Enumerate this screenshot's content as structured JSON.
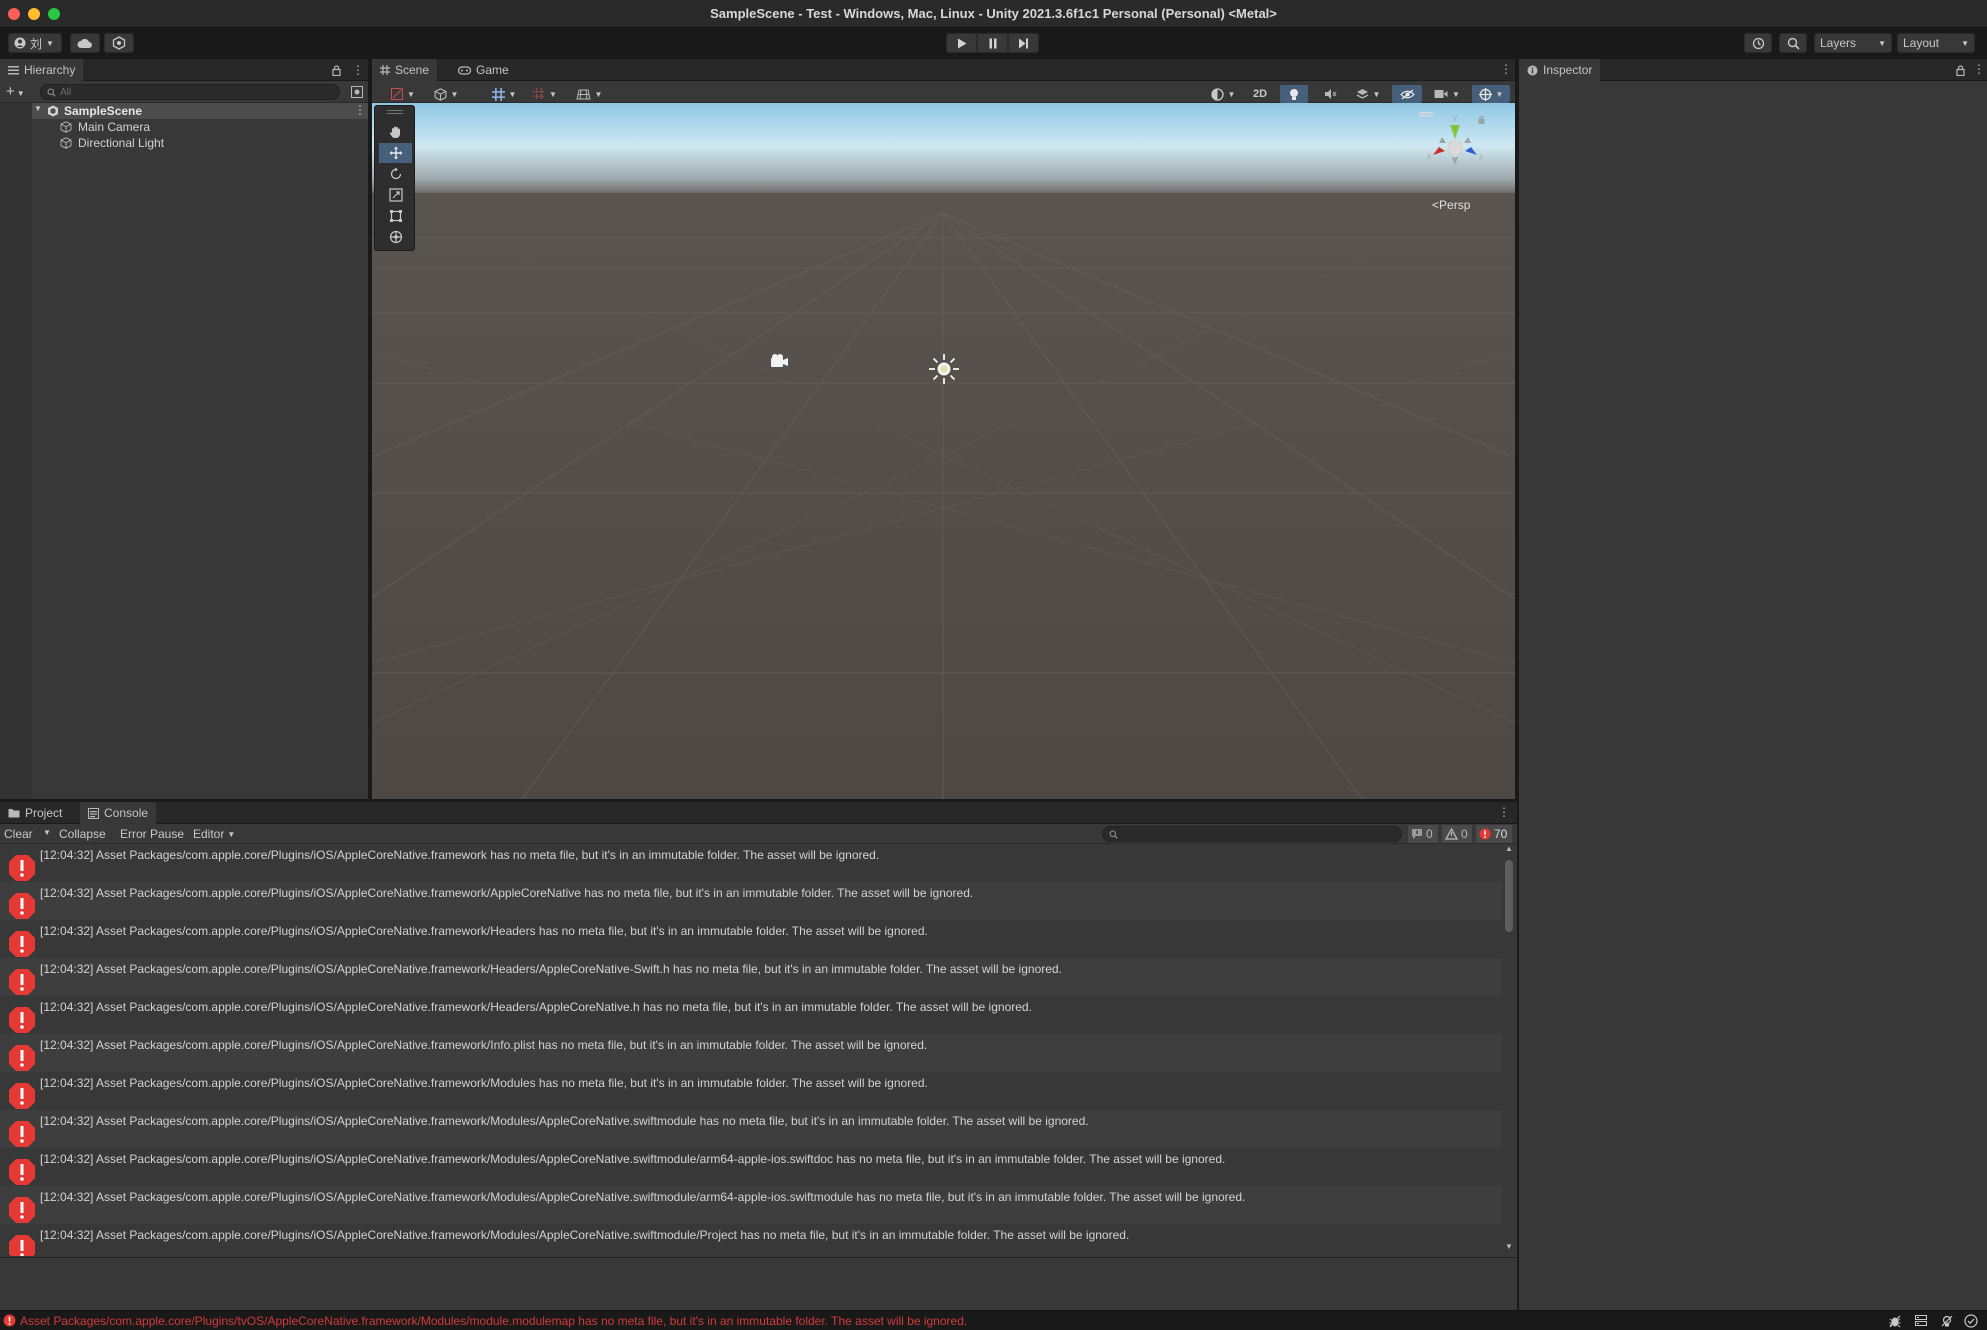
{
  "window": {
    "title": "SampleScene - Test - Windows, Mac, Linux - Unity 2021.3.6f1c1 Personal (Personal) <Metal>"
  },
  "toolbar": {
    "account_label": "刘",
    "layers_label": "Layers",
    "layout_label": "Layout"
  },
  "hierarchy": {
    "tab_label": "Hierarchy",
    "search_placeholder": "All",
    "scene_name": "SampleScene",
    "items": [
      {
        "label": "Main Camera"
      },
      {
        "label": "Directional Light"
      }
    ]
  },
  "scene": {
    "tabs": [
      {
        "label": "Scene"
      },
      {
        "label": "Game"
      }
    ],
    "toggle_2d": "2D",
    "persp_label": "Persp"
  },
  "inspector": {
    "tab_label": "Inspector"
  },
  "console": {
    "tabs": [
      {
        "label": "Project"
      },
      {
        "label": "Console"
      }
    ],
    "clear_label": "Clear",
    "collapse_label": "Collapse",
    "error_pause_label": "Error Pause",
    "editor_label": "Editor",
    "info_count": "0",
    "warning_count": "0",
    "error_count": "70",
    "logs": [
      {
        "text": "[12:04:32] Asset Packages/com.apple.core/Plugins/iOS/AppleCoreNative.framework has no meta file, but it's in an immutable folder. The asset will be ignored."
      },
      {
        "text": "[12:04:32] Asset Packages/com.apple.core/Plugins/iOS/AppleCoreNative.framework/AppleCoreNative has no meta file, but it's in an immutable folder. The asset will be ignored."
      },
      {
        "text": "[12:04:32] Asset Packages/com.apple.core/Plugins/iOS/AppleCoreNative.framework/Headers has no meta file, but it's in an immutable folder. The asset will be ignored."
      },
      {
        "text": "[12:04:32] Asset Packages/com.apple.core/Plugins/iOS/AppleCoreNative.framework/Headers/AppleCoreNative-Swift.h has no meta file, but it's in an immutable folder. The asset will be ignored."
      },
      {
        "text": "[12:04:32] Asset Packages/com.apple.core/Plugins/iOS/AppleCoreNative.framework/Headers/AppleCoreNative.h has no meta file, but it's in an immutable folder. The asset will be ignored."
      },
      {
        "text": "[12:04:32] Asset Packages/com.apple.core/Plugins/iOS/AppleCoreNative.framework/Info.plist has no meta file, but it's in an immutable folder. The asset will be ignored."
      },
      {
        "text": "[12:04:32] Asset Packages/com.apple.core/Plugins/iOS/AppleCoreNative.framework/Modules has no meta file, but it's in an immutable folder. The asset will be ignored."
      },
      {
        "text": "[12:04:32] Asset Packages/com.apple.core/Plugins/iOS/AppleCoreNative.framework/Modules/AppleCoreNative.swiftmodule has no meta file, but it's in an immutable folder. The asset will be ignored."
      },
      {
        "text": "[12:04:32] Asset Packages/com.apple.core/Plugins/iOS/AppleCoreNative.framework/Modules/AppleCoreNative.swiftmodule/arm64-apple-ios.swiftdoc has no meta file, but it's in an immutable folder. The asset will be ignored."
      },
      {
        "text": "[12:04:32] Asset Packages/com.apple.core/Plugins/iOS/AppleCoreNative.framework/Modules/AppleCoreNative.swiftmodule/arm64-apple-ios.swiftmodule has no meta file, but it's in an immutable folder. The asset will be ignored."
      },
      {
        "text": "[12:04:32] Asset Packages/com.apple.core/Plugins/iOS/AppleCoreNative.framework/Modules/AppleCoreNative.swiftmodule/Project has no meta file, but it's in an immutable folder. The asset will be ignored."
      }
    ]
  },
  "statusbar": {
    "message": "Asset Packages/com.apple.core/Plugins/tvOS/AppleCoreNative.framework/Modules/module.modulemap has no meta file, but it's in an immutable folder. The asset will be ignored."
  },
  "colors": {
    "error_red": "#e53935",
    "selection_blue": "#2c5d87",
    "sky_top": "#9fcfe9",
    "ground": "#544e4a"
  },
  "icons": [
    "play-icon",
    "pause-icon",
    "step-icon",
    "cloud-icon",
    "collab-icon",
    "history-icon",
    "search-icon",
    "hand-tool-icon",
    "move-tool-icon",
    "rotate-tool-icon",
    "scale-tool-icon",
    "rect-tool-icon",
    "transform-tool-icon",
    "camera-gizmo-icon",
    "light-gizmo-icon",
    "scene-gizmo-icon",
    "error-icon",
    "warning-icon",
    "info-icon",
    "lock-icon",
    "kebab-menu-icon"
  ]
}
